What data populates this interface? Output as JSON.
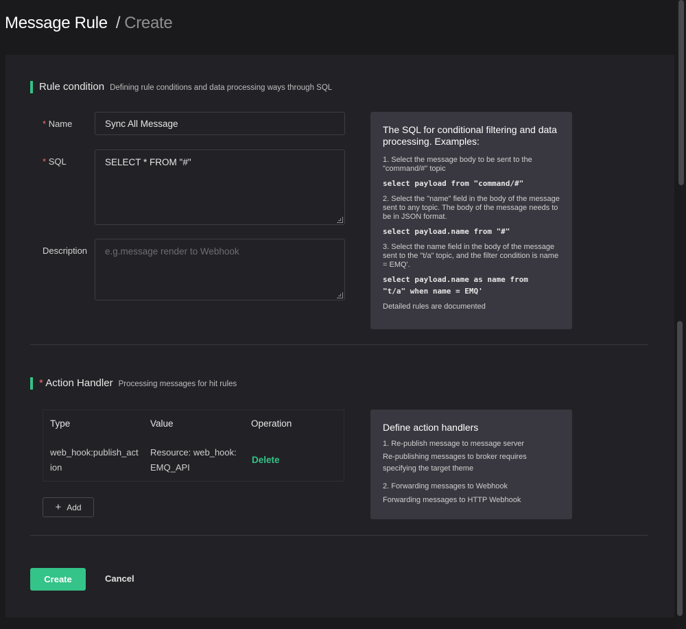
{
  "header": {
    "title": "Message Rule",
    "separator": "/",
    "subtitle": "Create"
  },
  "rule_condition": {
    "title": "Rule condition",
    "description": "Defining rule conditions and data processing ways through SQL",
    "fields": {
      "name": {
        "label": "Name",
        "value": "Sync All Message"
      },
      "sql": {
        "label": "SQL",
        "value": "SELECT * FROM \"#\""
      },
      "description": {
        "label": "Description",
        "placeholder": "e.g.message render to Webhook"
      }
    },
    "help": {
      "title": "The SQL for conditional filtering and data processing. Examples:",
      "ex1_text": "1. Select the message body to be sent to the \"command/#\" topic",
      "ex1_code": "select payload from \"command/#\"",
      "ex2_text": "2. Select the \"name\" field in the body of the message sent to any topic. The body of the message needs to be in JSON format.",
      "ex2_code": "select payload.name from \"#\"",
      "ex3_text": "3. Select the name field in the body of the message sent to the \"t/a\" topic, and the filter condition is name = EMQ'.",
      "ex3_code_line1": "select payload.name as name from",
      "ex3_code_line2": "\"t/a\" when name = EMQ'",
      "footer": "Detailed rules are documented"
    }
  },
  "action_handler": {
    "title": "Action Handler",
    "description": "Processing messages for hit rules",
    "table": {
      "headers": [
        "Type",
        "Value",
        "Operation"
      ],
      "rows": [
        {
          "type_line1": "web_hook:publish_act",
          "type_line2": "ion",
          "value_line1": "Resource: web_hook:",
          "value_line2": "EMQ_API",
          "operation": "Delete"
        }
      ]
    },
    "add_label": "Add",
    "help": {
      "title": "Define action handlers",
      "item1_title": "1. Re-publish message to message server",
      "item1_desc": "Re-publishing messages to broker requires specifying the target theme",
      "item2_title": "2. Forwarding messages to Webhook",
      "item2_desc": "Forwarding messages to HTTP Webhook"
    }
  },
  "footer": {
    "create_label": "Create",
    "cancel_label": "Cancel"
  },
  "colors": {
    "accent": "#34c388",
    "required": "#f56c6c",
    "background": "#1a191c",
    "card": "#222125",
    "help_box": "#393840"
  }
}
